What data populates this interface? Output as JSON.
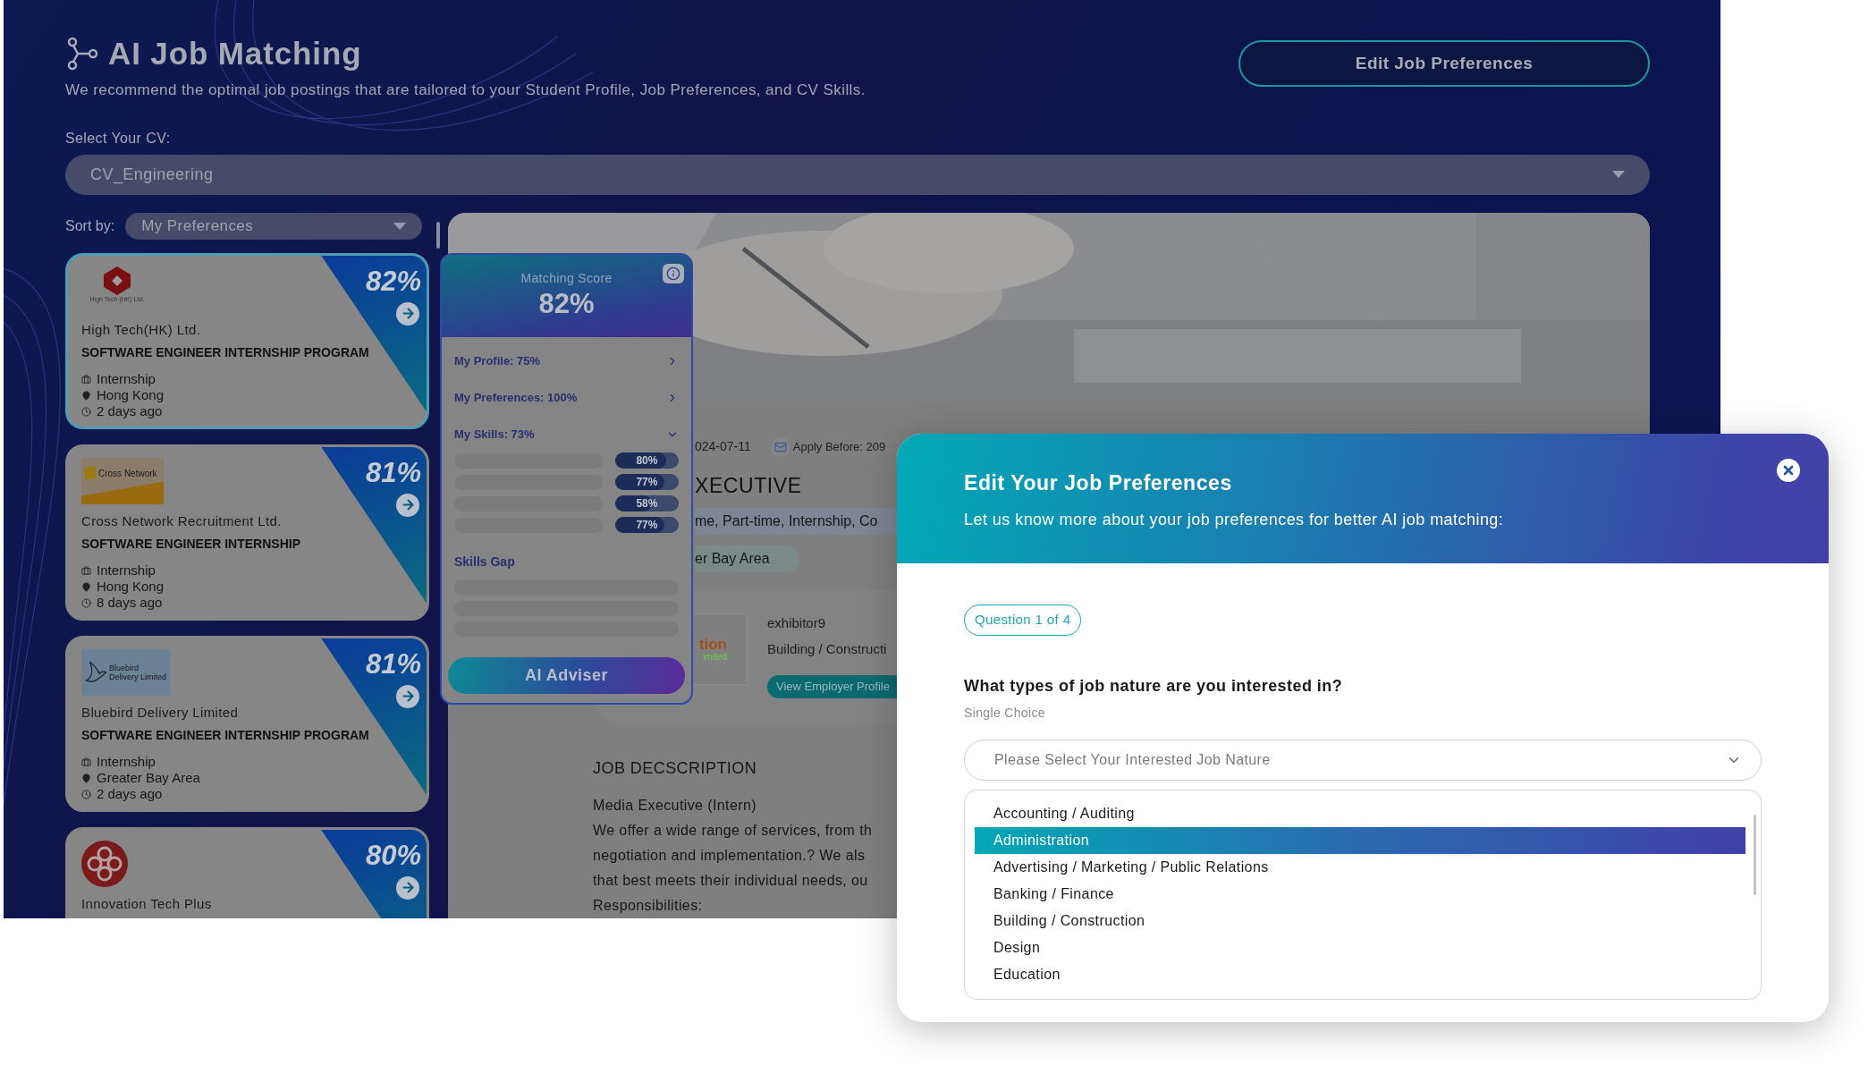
{
  "header": {
    "title": "AI Job Matching",
    "subtitle": "We recommend the optimal job postings that are tailored to your Student Profile, Job Preferences, and CV Skills.",
    "edit_button": "Edit Job Preferences"
  },
  "cv_select": {
    "label": "Select Your CV:",
    "value": "CV_Engineering"
  },
  "sort": {
    "label": "Sort by:",
    "value": "My Preferences"
  },
  "job_cards": [
    {
      "logo": {
        "kind": "hexagon",
        "text": "High Tech (HK) Ltd."
      },
      "company": "High Tech(HK) Ltd.",
      "title": "SOFTWARE ENGINEER INTERNSHIP PROGRAM",
      "job_type": "Internship",
      "location": "Hong Kong",
      "posted": "2 days ago",
      "score": "82%",
      "selected": true
    },
    {
      "logo": {
        "kind": "banner",
        "text": "Cross Network"
      },
      "company": "Cross Network Recruitment Ltd.",
      "title": "SOFTWARE ENGINEER INTERNSHIP",
      "job_type": "Internship",
      "location": "Hong Kong",
      "posted": "8 days ago",
      "score": "81%",
      "selected": false
    },
    {
      "logo": {
        "kind": "bird",
        "text": "Bluebird Delivery Limited"
      },
      "company": "Bluebird Delivery Limited",
      "title": "SOFTWARE ENGINEER INTERNSHIP PROGRAM",
      "job_type": "Internship",
      "location": "Greater Bay Area",
      "posted": "2 days ago",
      "score": "81%",
      "selected": false
    },
    {
      "logo": {
        "kind": "knot"
      },
      "company": "Innovation Tech Plus",
      "score": "80%",
      "selected": false
    }
  ],
  "matching_score": {
    "label": "Matching Score",
    "score": "82%",
    "breakdown": [
      {
        "label": "My Profile: 75%",
        "expanded": false
      },
      {
        "label": "My Preferences: 100%",
        "expanded": false
      },
      {
        "label": "My Skills: 73%",
        "expanded": true
      }
    ],
    "skills": [
      {
        "reading": "80%",
        "level": 0.8
      },
      {
        "reading": "77%",
        "level": 0.77
      },
      {
        "reading": "58%",
        "level": 0.58
      },
      {
        "reading": "77%",
        "level": 0.77
      }
    ],
    "skills_gap_title": "Skills Gap",
    "adviser_button": "AI Adviser"
  },
  "job_detail": {
    "posted": "024-07-11",
    "apply_before": "Apply Before: 209",
    "title": "XECUTIVE",
    "job_natures": "me, Part-time, Internship, Co",
    "location": "er Bay Area",
    "employer": {
      "logo_text": "tion",
      "logo_subtext": "imited",
      "name": "exhibitor9",
      "industry": "Building / Constructi",
      "button": "View Employer Profile"
    },
    "description_heading": "JOB DECSCRIPTION",
    "description": [
      "Media Executive (Intern)",
      "We offer a wide range of services, from th",
      "negotiation and implementation.? We als",
      "that best meets their individual needs, ou",
      "Responsibilities:"
    ]
  },
  "modal": {
    "title": "Edit Your Job Preferences",
    "subtitle": "Let us know more about your job preferences for better AI job matching:",
    "question_badge": "Question 1 of 4",
    "question": "What types of job nature are you interested in?",
    "hint": "Single Choice",
    "select": {
      "placeholder": "Please Select Your Interested Job Nature"
    },
    "options": [
      {
        "label": "Accounting / Auditing",
        "selected": false
      },
      {
        "label": "Administration",
        "selected": true
      },
      {
        "label": "Advertising / Marketing / Public Relations",
        "selected": false
      },
      {
        "label": "Banking / Finance",
        "selected": false
      },
      {
        "label": "Building / Construction",
        "selected": false
      },
      {
        "label": "Design",
        "selected": false
      },
      {
        "label": "Education",
        "selected": false
      }
    ]
  }
}
